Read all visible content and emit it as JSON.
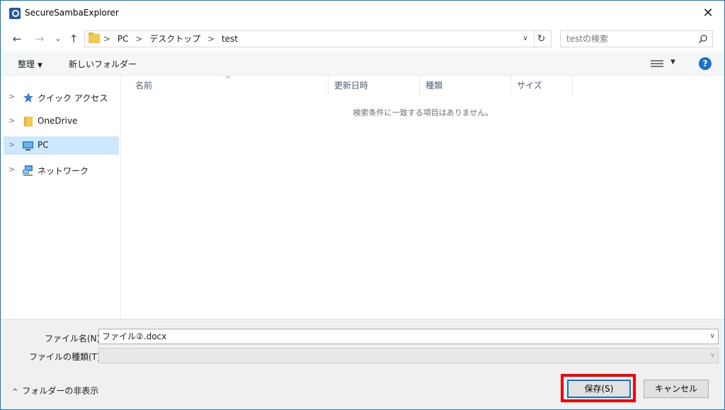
{
  "window": {
    "title": "SecureSambaExplorer",
    "close_glyph": "✕",
    "accent_color": "#1979ca"
  },
  "nav": {
    "back_glyph": "←",
    "forward_glyph": "→",
    "recent_glyph": "⌄",
    "up_glyph": "↑"
  },
  "address": {
    "crumbs": [
      "PC",
      "デスクトップ",
      "test"
    ],
    "separator": ">",
    "dropdown_glyph": "∨",
    "refresh_glyph": "↻"
  },
  "search": {
    "placeholder": "testの検索",
    "icon": "search-icon"
  },
  "toolbar": {
    "organize_label": "整理",
    "organize_caret": "▼",
    "new_folder_label": "新しいフォルダー",
    "view_caret": "▼",
    "help_label": "?"
  },
  "sidebar": {
    "items": [
      {
        "label": "クイック アクセス",
        "icon": "star-icon",
        "selected": false
      },
      {
        "label": "OneDrive",
        "icon": "folder-icon",
        "selected": false
      },
      {
        "label": "PC",
        "icon": "computer-icon",
        "selected": true
      },
      {
        "label": "ネットワーク",
        "icon": "network-icon",
        "selected": false
      }
    ],
    "chevron": ">"
  },
  "columns": {
    "headers": [
      "名前",
      "更新日時",
      "種類",
      "サイズ"
    ],
    "sort_indicator": "^"
  },
  "content": {
    "empty_message": "検索条件に一致する項目はありません。"
  },
  "footer": {
    "filename_label": "ファイル名(N):",
    "filename_value": "ファイル②.docx",
    "filetype_label": "ファイルの種類(T):",
    "filetype_value": "",
    "caret": "∨",
    "hide_folders_label": "フォルダーの非表示",
    "hide_folders_glyph": "^",
    "save_label": "保存(S)",
    "cancel_label": "キャンセル",
    "highlight_color": "#ff0000"
  }
}
